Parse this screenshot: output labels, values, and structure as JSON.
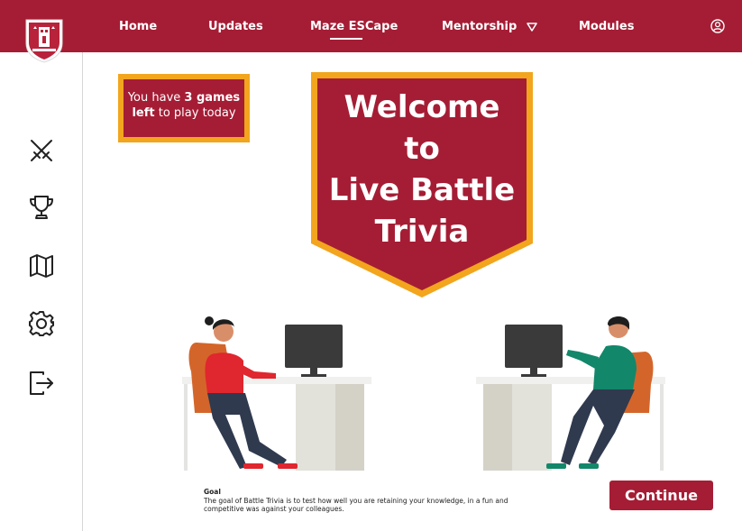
{
  "nav": {
    "items": [
      {
        "label": "Home"
      },
      {
        "label": "Updates"
      },
      {
        "label": "Maze ESCape"
      },
      {
        "label": "Mentorship"
      },
      {
        "label": "Modules"
      }
    ]
  },
  "sidebar": {
    "items": [
      {
        "icon": "crossed-swords-icon"
      },
      {
        "icon": "trophy-icon"
      },
      {
        "icon": "map-icon"
      },
      {
        "icon": "gear-icon"
      },
      {
        "icon": "logout-icon"
      }
    ]
  },
  "games_left": {
    "prefix": "You have ",
    "count": "3",
    "bold_suffix": " games left",
    "suffix": " to play today"
  },
  "banner": {
    "line1": "Welcome",
    "line2": "to",
    "line3": "Live Battle",
    "line4": "Trivia"
  },
  "goal": {
    "title": "Goal",
    "text": "The goal of Battle Trivia is to test how well you are retaining your knowledge, in a fun and competitive was against your colleagues."
  },
  "continue_label": "Continue",
  "colors": {
    "brand": "#a51d35",
    "accent": "#f2a51d"
  }
}
